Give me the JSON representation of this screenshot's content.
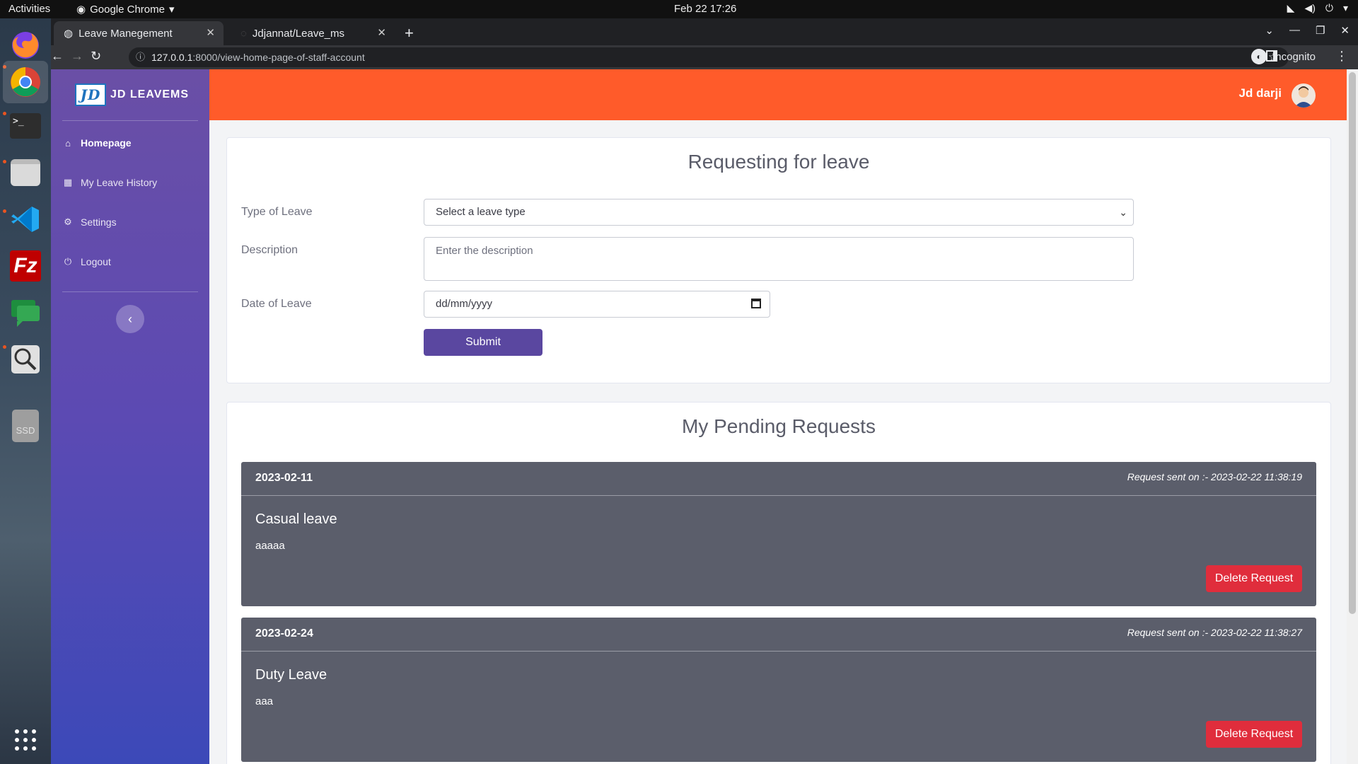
{
  "system": {
    "activities": "Activities",
    "app_name": "Google Chrome",
    "clock": "Feb 22  17:26"
  },
  "browser": {
    "tabs": [
      {
        "label": "Leave Manegement",
        "active": true
      },
      {
        "label": "Jdjannat/Leave_ms",
        "active": false
      }
    ],
    "url_host": "127.0.0.1",
    "url_rest": ":8000/view-home-page-of-staff-account",
    "incognito_label": "Incognito"
  },
  "dock": {
    "items": [
      "firefox-icon",
      "chrome-icon",
      "terminal-icon",
      "files-icon",
      "vscode-icon",
      "filezilla-icon",
      "chat-icon",
      "magnifier-icon",
      "ssd-icon"
    ],
    "ssd_label": "SSD"
  },
  "sidebar": {
    "logo_text": "JD",
    "brand": "JD LEAVEMS",
    "items": [
      {
        "label": "Homepage",
        "icon": "home-icon",
        "active": true
      },
      {
        "label": "My Leave History",
        "icon": "calculator-icon",
        "active": false
      },
      {
        "label": "Settings",
        "icon": "gear-icon",
        "active": false
      },
      {
        "label": "Logout",
        "icon": "power-icon",
        "active": false
      }
    ],
    "collapse_glyph": "‹"
  },
  "header": {
    "username": "Jd darji"
  },
  "form": {
    "title": "Requesting for leave",
    "type_label": "Type of Leave",
    "type_placeholder": "Select a leave type",
    "desc_label": "Description",
    "desc_placeholder": "Enter the description",
    "date_label": "Date of Leave",
    "date_placeholder": "dd/mm/yyyy",
    "submit_label": "Submit"
  },
  "pending": {
    "title": "My Pending Requests",
    "requests": [
      {
        "date": "2023-02-11",
        "sent": "Request sent on :- 2023-02-22 11:38:19",
        "type": "Casual leave",
        "description": "aaaaa",
        "delete_label": "Delete Request"
      },
      {
        "date": "2023-02-24",
        "sent": "Request sent on :- 2023-02-22 11:38:27",
        "type": "Duty Leave",
        "description": "aaa",
        "delete_label": "Delete Request"
      }
    ]
  },
  "colors": {
    "header": "#ff5b2a",
    "sidebar_top": "#6a4fa6",
    "sidebar_bottom": "#3c49b8",
    "submit": "#5a47a0",
    "request_card": "#5b5e6b",
    "delete": "#e02d3c"
  }
}
